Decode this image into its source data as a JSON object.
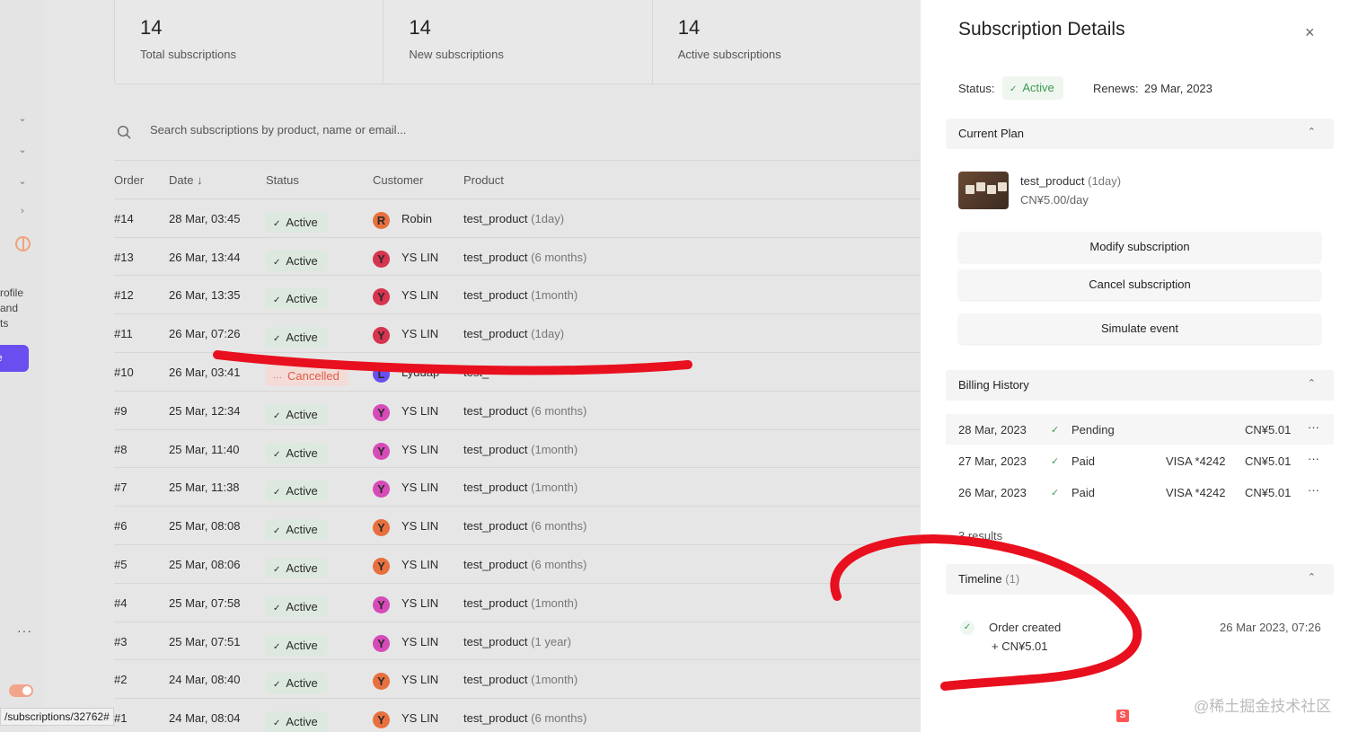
{
  "sidebar": {
    "text_lines": [
      "rofile",
      "and",
      "ts"
    ],
    "button_label": "e",
    "dots": "···",
    "url_tooltip": "/subscriptions/32762#"
  },
  "stats": [
    {
      "value": "14",
      "label": "Total subscriptions"
    },
    {
      "value": "14",
      "label": "New subscriptions"
    },
    {
      "value": "14",
      "label": "Active subscriptions"
    }
  ],
  "search": {
    "placeholder": "Search subscriptions by product, name or email..."
  },
  "table": {
    "headers": {
      "order": "Order",
      "date": "Date ↓",
      "status": "Status",
      "customer": "Customer",
      "product": "Product"
    },
    "rows": [
      {
        "order": "#14",
        "date": "28 Mar, 03:45",
        "status": "Active",
        "initial": "R",
        "avatar_color": "#e8703f",
        "customer": "Robin",
        "product": "test_product",
        "variant": "(1day)"
      },
      {
        "order": "#13",
        "date": "26 Mar, 13:44",
        "status": "Active",
        "initial": "Y",
        "avatar_color": "#d6344f",
        "customer": "YS LIN",
        "product": "test_product",
        "variant": "(6 months)"
      },
      {
        "order": "#12",
        "date": "26 Mar, 13:35",
        "status": "Active",
        "initial": "Y",
        "avatar_color": "#d6344f",
        "customer": "YS LIN",
        "product": "test_product",
        "variant": "(1month)"
      },
      {
        "order": "#11",
        "date": "26 Mar, 07:26",
        "status": "Active",
        "initial": "Y",
        "avatar_color": "#d6344f",
        "customer": "YS LIN",
        "product": "test_product",
        "variant": "(1day)"
      },
      {
        "order": "#10",
        "date": "26 Mar, 03:41",
        "status": "Cancelled",
        "initial": "L",
        "avatar_color": "#6b4ef0",
        "customer": "Lyduap",
        "product": "test_",
        "variant": ""
      },
      {
        "order": "#9",
        "date": "25 Mar, 12:34",
        "status": "Active",
        "initial": "Y",
        "avatar_color": "#d64bb8",
        "customer": "YS LIN",
        "product": "test_product",
        "variant": "(6 months)"
      },
      {
        "order": "#8",
        "date": "25 Mar, 11:40",
        "status": "Active",
        "initial": "Y",
        "avatar_color": "#d64bb8",
        "customer": "YS LIN",
        "product": "test_product",
        "variant": "(1month)"
      },
      {
        "order": "#7",
        "date": "25 Mar, 11:38",
        "status": "Active",
        "initial": "Y",
        "avatar_color": "#d64bb8",
        "customer": "YS LIN",
        "product": "test_product",
        "variant": "(1month)"
      },
      {
        "order": "#6",
        "date": "25 Mar, 08:08",
        "status": "Active",
        "initial": "Y",
        "avatar_color": "#e8703f",
        "customer": "YS LIN",
        "product": "test_product",
        "variant": "(6 months)"
      },
      {
        "order": "#5",
        "date": "25 Mar, 08:06",
        "status": "Active",
        "initial": "Y",
        "avatar_color": "#e8703f",
        "customer": "YS LIN",
        "product": "test_product",
        "variant": "(6 months)"
      },
      {
        "order": "#4",
        "date": "25 Mar, 07:58",
        "status": "Active",
        "initial": "Y",
        "avatar_color": "#d64bb8",
        "customer": "YS LIN",
        "product": "test_product",
        "variant": "(1month)"
      },
      {
        "order": "#3",
        "date": "25 Mar, 07:51",
        "status": "Active",
        "initial": "Y",
        "avatar_color": "#d64bb8",
        "customer": "YS LIN",
        "product": "test_product",
        "variant": "(1 year)"
      },
      {
        "order": "#2",
        "date": "24 Mar, 08:40",
        "status": "Active",
        "initial": "Y",
        "avatar_color": "#e8703f",
        "customer": "YS LIN",
        "product": "test_product",
        "variant": "(1month)"
      },
      {
        "order": "#1",
        "date": "24 Mar, 08:04",
        "status": "Active",
        "initial": "Y",
        "avatar_color": "#e8703f",
        "customer": "YS LIN",
        "product": "test_product",
        "variant": "(6 months)"
      }
    ]
  },
  "panel": {
    "title": "Subscription Details",
    "close_icon": "×",
    "status_label": "Status:",
    "status_value": "Active",
    "renews_label": "Renews:",
    "renews_value": "29 Mar, 2023",
    "current_plan": {
      "heading": "Current Plan",
      "product": "test_product",
      "variant": "(1day)",
      "price": "CN¥5.00/day"
    },
    "buttons": {
      "modify": "Modify subscription",
      "cancel": "Cancel subscription",
      "simulate": "Simulate event"
    },
    "billing": {
      "heading": "Billing History",
      "rows": [
        {
          "date": "28 Mar, 2023",
          "status": "Pending",
          "card": "",
          "amount": "CN¥5.01"
        },
        {
          "date": "27 Mar, 2023",
          "status": "Paid",
          "card": "VISA *4242",
          "amount": "CN¥5.01"
        },
        {
          "date": "26 Mar, 2023",
          "status": "Paid",
          "card": "VISA *4242",
          "amount": "CN¥5.01"
        }
      ],
      "results": "3 results"
    },
    "timeline": {
      "heading": "Timeline",
      "count": "(1)",
      "event": "Order created",
      "amount": "+ CN¥5.01",
      "time": "26 Mar 2023, 07:26"
    },
    "watermark": "@稀土掘金技术社区"
  },
  "colors": {
    "accent": "#6b4ef0",
    "active": "#3f9b58",
    "cancelled": "#e05a45",
    "annotation": "#e8101e"
  }
}
